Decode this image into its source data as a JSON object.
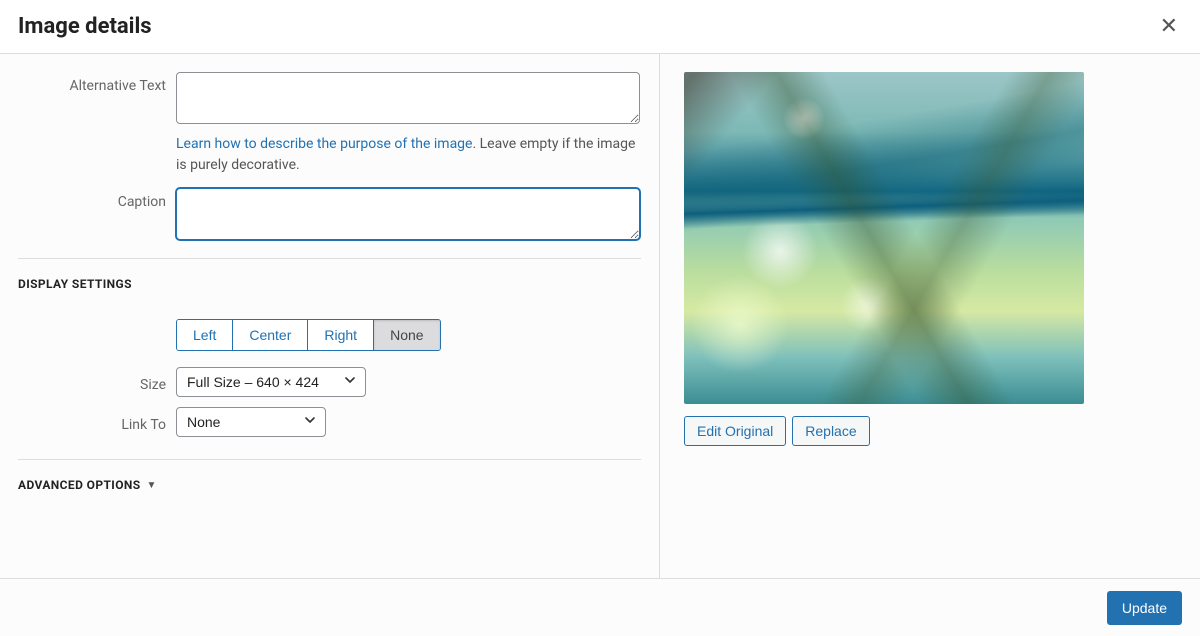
{
  "header": {
    "title": "Image details"
  },
  "form": {
    "alt_text": {
      "label": "Alternative Text",
      "value": "",
      "help_link_text": "Learn how to describe the purpose of the image",
      "help_suffix": ". Leave empty if the image is purely decorative."
    },
    "caption": {
      "label": "Caption",
      "value": ""
    }
  },
  "display_settings": {
    "heading": "DISPLAY SETTINGS",
    "align": {
      "options": [
        "Left",
        "Center",
        "Right",
        "None"
      ],
      "selected": "None"
    },
    "size": {
      "label": "Size",
      "selected": "Full Size – 640 × 424"
    },
    "link_to": {
      "label": "Link To",
      "selected": "None"
    }
  },
  "advanced": {
    "heading": "ADVANCED OPTIONS",
    "expanded": false
  },
  "preview": {
    "edit_original_label": "Edit Original",
    "replace_label": "Replace"
  },
  "footer": {
    "update_label": "Update"
  }
}
